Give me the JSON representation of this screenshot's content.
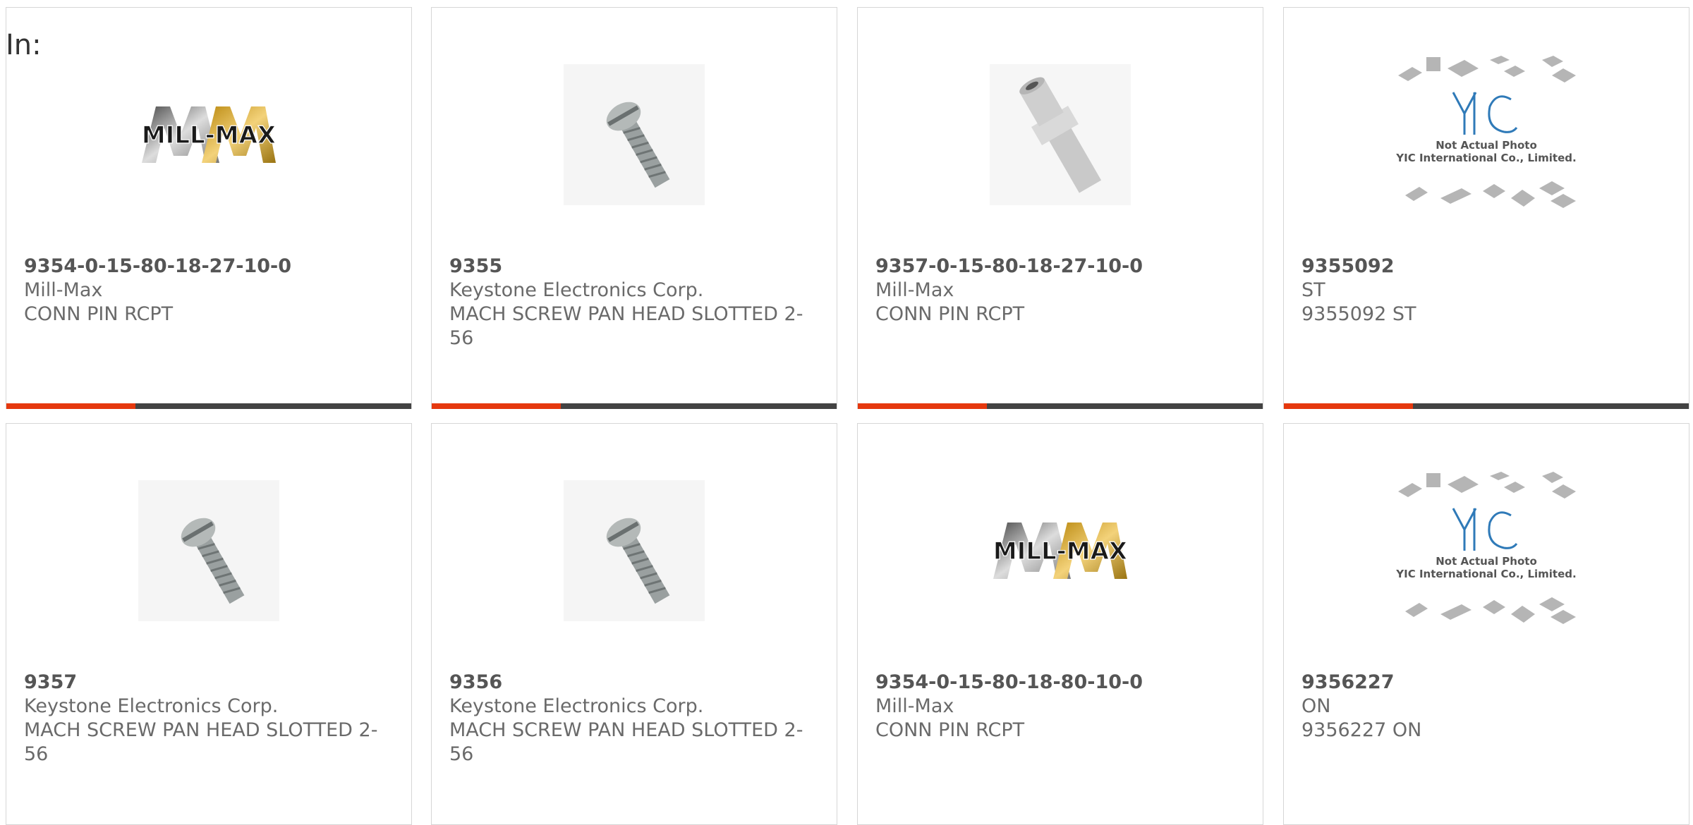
{
  "header": {
    "filter_label": "In:"
  },
  "colors": {
    "accent_bar": "#e5380e",
    "bar_dark": "#434343",
    "text": "#666666"
  },
  "products": [
    {
      "part_number": "9354-0-15-80-18-27-10-0",
      "manufacturer": "Mill-Max",
      "description": "CONN PIN RCPT",
      "image": "mill-max-logo"
    },
    {
      "part_number": "9355",
      "manufacturer": "Keystone Electronics Corp.",
      "description": "MACH SCREW PAN HEAD SLOTTED 2-56",
      "image": "screw-photo"
    },
    {
      "part_number": "9357-0-15-80-18-27-10-0",
      "manufacturer": "Mill-Max",
      "description": "CONN PIN RCPT",
      "image": "pin-receptacle-photo"
    },
    {
      "part_number": "9355092",
      "manufacturer": "ST",
      "description": "9355092 ST",
      "image": "yic-placeholder",
      "placeholder_text": [
        "Not Actual Photo",
        "YIC International Co., Limited."
      ]
    },
    {
      "part_number": "9357",
      "manufacturer": "Keystone Electronics Corp.",
      "description": "MACH SCREW PAN HEAD SLOTTED 2-56",
      "image": "screw-photo"
    },
    {
      "part_number": "9356",
      "manufacturer": "Keystone Electronics Corp.",
      "description": "MACH SCREW PAN HEAD SLOTTED 2-56",
      "image": "screw-photo"
    },
    {
      "part_number": "9354-0-15-80-18-80-10-0",
      "manufacturer": "Mill-Max",
      "description": "CONN PIN RCPT",
      "image": "mill-max-logo"
    },
    {
      "part_number": "9356227",
      "manufacturer": "ON",
      "description": "9356227 ON",
      "image": "yic-placeholder",
      "placeholder_text": [
        "Not Actual Photo",
        "YIC International Co., Limited."
      ]
    }
  ]
}
